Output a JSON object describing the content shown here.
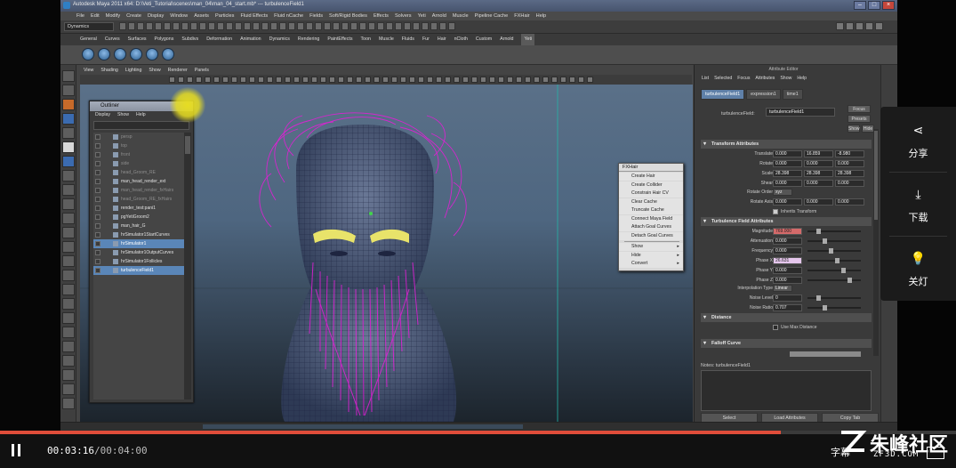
{
  "window": {
    "title": "Autodesk Maya 2011 x64: D:\\Veti_Tutorial\\scenes\\man_04\\man_04_start.mb* --- turbulenceField1"
  },
  "menubar": [
    "File",
    "Edit",
    "Modify",
    "Create",
    "Display",
    "Window",
    "Assets",
    "Particles",
    "Fluid Effects",
    "Fluid nCache",
    "Fields",
    "Soft/Rigid Bodies",
    "Effects",
    "Solvers",
    "Yeti",
    "Arnold",
    "Muscle",
    "Pipeline Cache",
    "FXHair",
    "Help"
  ],
  "status_line": {
    "menu_set": "Dynamics"
  },
  "shelf_tabs": [
    "General",
    "Curves",
    "Surfaces",
    "Polygons",
    "Subdivs",
    "Deformation",
    "Animation",
    "Dynamics",
    "Rendering",
    "PaintEffects",
    "Toon",
    "Muscle",
    "Fluids",
    "Fur",
    "Hair",
    "nCloth",
    "Custom",
    "Arnold",
    "Yeti"
  ],
  "shelf_tab_active": "Yeti",
  "viewport_menu": [
    "View",
    "Shading",
    "Lighting",
    "Show",
    "Renderer",
    "Panels"
  ],
  "outliner": {
    "title": "Outliner",
    "menu": [
      "Display",
      "Show",
      "Help"
    ],
    "items": [
      {
        "label": "persp",
        "dim": true,
        "sel": false
      },
      {
        "label": "top",
        "dim": true,
        "sel": false
      },
      {
        "label": "front",
        "dim": true,
        "sel": false
      },
      {
        "label": "side",
        "dim": true,
        "sel": false
      },
      {
        "label": "head_Groom_RE",
        "dim": true,
        "sel": false
      },
      {
        "label": "man_head_render_ext",
        "dim": false,
        "sel": false
      },
      {
        "label": "man_head_render_fxHairs",
        "dim": true,
        "sel": false
      },
      {
        "label": "head_Groom_RE_fxHairs",
        "dim": true,
        "sel": false
      },
      {
        "label": "render_test:pani1",
        "dim": false,
        "sel": false
      },
      {
        "label": "pgYetiGroom2",
        "dim": false,
        "sel": false
      },
      {
        "label": "man_hair_G",
        "dim": false,
        "sel": false
      },
      {
        "label": "hrSimulator1StartCurves",
        "dim": false,
        "sel": false
      },
      {
        "label": "hrSimulator1",
        "dim": false,
        "sel": true
      },
      {
        "label": "hrSimulator1OutputCurves",
        "dim": false,
        "sel": false
      },
      {
        "label": "hrSimulator1Follicles",
        "dim": false,
        "sel": false
      },
      {
        "label": "turbulenceField1",
        "dim": false,
        "sel": true
      }
    ]
  },
  "fxhair_menu": {
    "title": "FXHair",
    "items": [
      {
        "label": "Create Hair",
        "arrow": ""
      },
      {
        "label": "Create Collider",
        "arrow": ""
      },
      {
        "label": "Constrain Hair CV",
        "arrow": ""
      },
      {
        "label": "Clear Cache",
        "arrow": ""
      },
      {
        "label": "Truncate Cache",
        "arrow": ""
      },
      {
        "label": "Connect Maya Field",
        "arrow": ""
      },
      {
        "label": "Attach Goal Curves",
        "arrow": ""
      },
      {
        "label": "Detach Goal Curves",
        "arrow": ""
      },
      {
        "label": "Show",
        "arrow": "▸"
      },
      {
        "label": "Hide",
        "arrow": "▸"
      },
      {
        "label": "Convert",
        "arrow": "▸"
      }
    ]
  },
  "attribute_editor": {
    "title": "Attribute Editor",
    "menu": [
      "List",
      "Selected",
      "Focus",
      "Attributes",
      "Show",
      "Help"
    ],
    "tabs": [
      "turbulenceField1",
      "expression1",
      "time1"
    ],
    "active_tab": "turbulenceField1",
    "node_label": "turbulenceField:",
    "node_value": "turbulenceField1",
    "buttons": {
      "focus": "Focus",
      "presets": "Presets",
      "show": "Show",
      "hide": "Hide"
    },
    "sections": {
      "transform": "Transform Attributes",
      "turbulence": "Turbulence Field Attributes",
      "distance": "Distance",
      "falloff": "Falloff Curve"
    },
    "transform_rows": [
      {
        "label": "Translate",
        "v": [
          "0.000",
          "16.859",
          "-8.980"
        ]
      },
      {
        "label": "Rotate",
        "v": [
          "0.000",
          "0.000",
          "0.000"
        ]
      },
      {
        "label": "Scale",
        "v": [
          "28.398",
          "28.398",
          "28.398"
        ]
      },
      {
        "label": "Shear",
        "v": [
          "0.000",
          "0.000",
          "0.000"
        ]
      }
    ],
    "rotate_order": {
      "label": "Rotate Order",
      "value": "xyz"
    },
    "rotate_axis": {
      "label": "Rotate Axis",
      "v": [
        "0.000",
        "0.000",
        "0.000"
      ]
    },
    "inherits_transform": "Inherits Transform",
    "turb_rows": [
      {
        "label": "Magnitude",
        "value": "769.000",
        "style": "red"
      },
      {
        "label": "Attenuation",
        "value": "0.000",
        "style": ""
      },
      {
        "label": "Frequency",
        "value": "0.000",
        "style": ""
      },
      {
        "label": "Phase X",
        "value": "26.631",
        "style": "pink"
      },
      {
        "label": "Phase Y",
        "value": "0.000",
        "style": ""
      },
      {
        "label": "Phase Z",
        "value": "0.000",
        "style": ""
      }
    ],
    "interp_type": {
      "label": "Interpolation Type",
      "value": "Linear"
    },
    "noise_rows": [
      {
        "label": "Noise Level",
        "value": "0",
        "style": ""
      },
      {
        "label": "Noise Ratio",
        "value": "0.707",
        "style": ""
      }
    ],
    "use_max_distance": "Use Max Distance",
    "notes_label": "Notes: turbulenceField1",
    "footer": [
      "Select",
      "Load Attributes",
      "Copy Tab"
    ]
  },
  "side_actions": [
    {
      "icon": "share-icon",
      "glyph": "⋖",
      "label": "分享"
    },
    {
      "icon": "download-icon",
      "glyph": "⤓",
      "label": "下载"
    },
    {
      "icon": "lightbulb-icon",
      "glyph": "💡",
      "label": "关灯"
    }
  ],
  "player": {
    "current_time": "00:03:16",
    "total_time": "/00:04:00",
    "progress": 0.817,
    "subtitle_label": "字幕"
  },
  "watermark": {
    "text": "朱峰社区",
    "url": "ZF3D.COM"
  },
  "colors": {
    "accent_progress": "#e04d3a",
    "hair": "#e21fd6",
    "selection": "#5a86b8"
  }
}
